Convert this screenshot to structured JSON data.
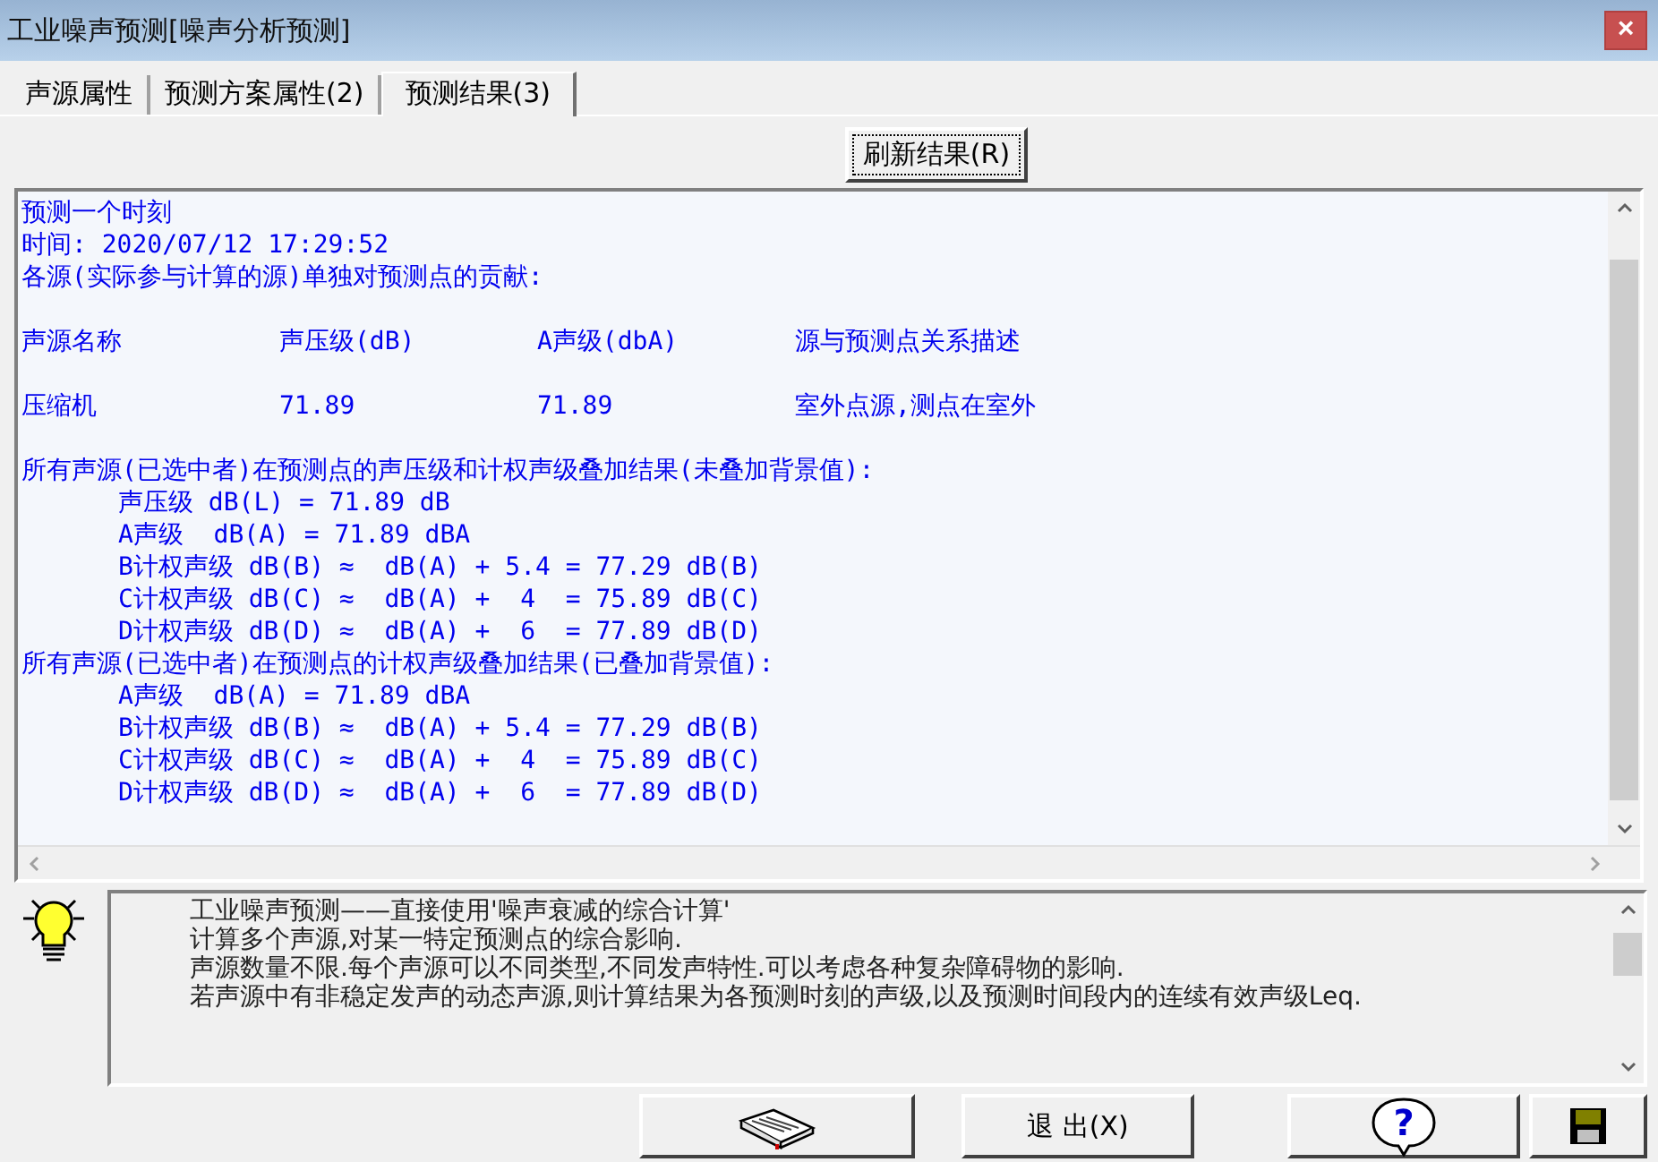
{
  "window": {
    "title": "工业噪声预测[噪声分析预测]",
    "close": "×"
  },
  "tabs": [
    {
      "label": "声源属性",
      "selected": false
    },
    {
      "label": "预测方案属性(2)",
      "selected": false
    },
    {
      "label": "预测结果(3)",
      "selected": true
    }
  ],
  "refresh_button": "刷新结果(R)",
  "result": {
    "lines_before": [
      "预测一个时刻",
      "时间: 2020/07/12 17:29:52",
      "各源(实际参与计算的源)单独对预测点的贡献:"
    ],
    "table": {
      "columns": [
        "声源名称",
        "声压级(dB)",
        "A声级(dbA)",
        "源与预测点关系描述"
      ],
      "rows": [
        [
          "压缩机",
          "71.89",
          "71.89",
          "室外点源,测点在室外"
        ]
      ]
    },
    "summaries": [
      {
        "text": "所有声源(已选中者)在预测点的声压级和计权声级叠加结果(未叠加背景值):",
        "children": [
          {
            "text": "声压级 dB(L) = 71.89 dB"
          },
          {
            "text": "A声级  dB(A) = 71.89 dBA"
          },
          {
            "text": "B计权声级 dB(B) ≈  dB(A) + 5.4 = 77.29 dB(B)"
          },
          {
            "text": "C计权声级 dB(C) ≈  dB(A) +  4  = 75.89 dB(C)"
          },
          {
            "text": "D计权声级 dB(D) ≈  dB(A) +  6  = 77.89 dB(D)"
          }
        ]
      },
      {
        "text": "所有声源(已选中者)在预测点的计权声级叠加结果(已叠加背景值):",
        "children": [
          {
            "text": "A声级  dB(A) = 71.89 dBA"
          },
          {
            "text": "B计权声级 dB(B) ≈  dB(A) + 5.4 = 77.29 dB(B)"
          },
          {
            "text": "C计权声级 dB(C) ≈  dB(A) +  4  = 75.89 dB(C)"
          },
          {
            "text": "D计权声级 dB(D) ≈  dB(A) +  6  = 77.89 dB(D)"
          }
        ]
      }
    ]
  },
  "info": {
    "paragraphs": [
      "工业噪声预测——直接使用'噪声衰减的综合计算'",
      "计算多个声源,对某一特定预测点的综合影响.",
      "声源数量不限.每个声源可以不同类型,不同发声特性.可以考虑各种复杂障碍物的影响.",
      "若声源中有非稳定发声的动态声源,则计算结果为各预测时刻的声级,以及预测时间段内的连续有效声级Leq."
    ]
  },
  "buttons": [
    {
      "kind": "book"
    },
    {
      "kind": "text",
      "label": "退 出(X)"
    },
    {
      "kind": "help",
      "glyph": "?"
    },
    {
      "kind": "save"
    }
  ]
}
